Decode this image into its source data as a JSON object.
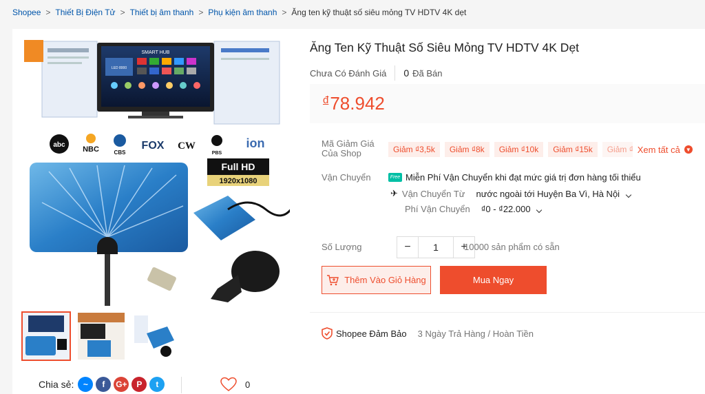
{
  "breadcrumb": {
    "items": [
      "Shopee",
      "Thiết Bị Điện Tử",
      "Thiết bị âm thanh",
      "Phụ kiện âm thanh"
    ],
    "current": "Ăng ten kỹ thuật số siêu mỏng TV HDTV 4K dẹt"
  },
  "product": {
    "title": "Ăng Ten Kỹ Thuật Số Siêu Mỏng TV HDTV 4K Dẹt",
    "rating_text": "Chưa Có Đánh Giá",
    "sold_count": "0",
    "sold_label": "Đã Bán",
    "currency": "đ",
    "price": "78.942"
  },
  "image": {
    "hub_label": "SMART HUB",
    "tv_label": "LED 8000",
    "channels": [
      "abc",
      "NBC",
      "CBS",
      "FOX",
      "CW",
      "PBS",
      "ion"
    ],
    "fullhd_top": "Full HD",
    "fullhd_bottom": "1920x1080"
  },
  "vouchers": {
    "label": "Mã Giảm Giá Của Shop",
    "items": [
      "Giảm ₫3,5k",
      "Giảm ₫8k",
      "Giảm ₫10k",
      "Giảm ₫15k",
      "Giảm ₫"
    ],
    "see_all": "Xem tất cả"
  },
  "shipping": {
    "label": "Vận Chuyển",
    "free_badge": "Free",
    "free_text": "Miễn Phí Vận Chuyển khi đạt mức giá trị đơn hàng tối thiểu",
    "from_label": "Vận Chuyển Từ",
    "from_value": "nước ngoài tới Huyện Ba Vì, Hà Nội",
    "fee_label": "Phí Vận Chuyển",
    "fee_value": "₫0 - ₫22.000"
  },
  "quantity": {
    "label": "Số Lượng",
    "minus": "−",
    "value": "1",
    "plus": "+",
    "stock_text": "10000 sản phẩm có sẵn"
  },
  "actions": {
    "add_to_cart": "Thêm Vào Giỏ Hàng",
    "buy_now": "Mua Ngay"
  },
  "guarantee": {
    "name": "Shopee Đảm Bảo",
    "text": "3 Ngày Trả Hàng / Hoàn Tiền"
  },
  "share": {
    "label": "Chia sẻ:",
    "likes": "0"
  },
  "colors": {
    "accent": "#ee4d2d",
    "voucher_bg": "#fdeeea",
    "free_ship": "#00bfa5"
  }
}
